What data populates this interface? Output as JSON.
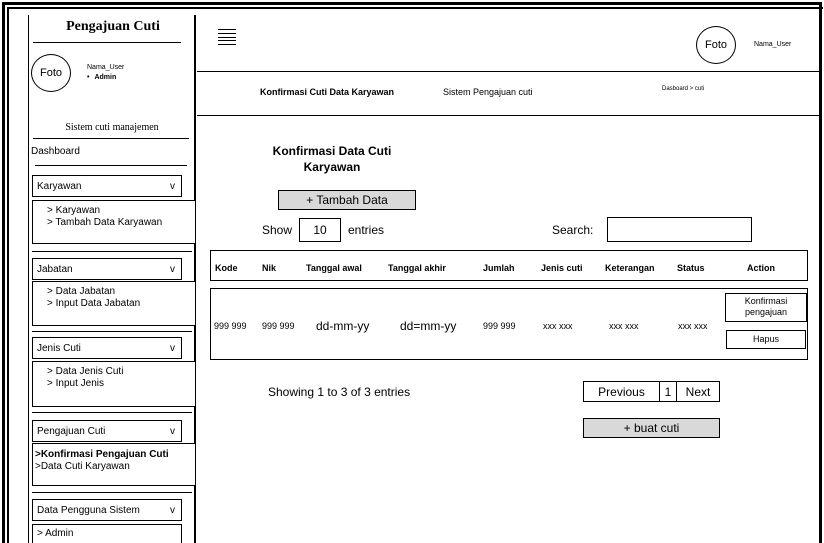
{
  "sidebar": {
    "app_title": "Pengajuan Cuti",
    "foto_label": "Foto",
    "user_name": "Nama_User",
    "user_role": "Admin",
    "subtitle": "Sistem cuti manajemen",
    "dashboard": "Dashboard",
    "karyawan": {
      "label": "Karyawan",
      "chevron": "v",
      "items": [
        "> Karyawan",
        "> Tambah Data Karyawan"
      ]
    },
    "jabatan": {
      "label": "Jabatan",
      "chevron": "v",
      "items": [
        "> Data Jabatan",
        "> Input Data Jabatan"
      ]
    },
    "jenis_cuti": {
      "label": "Jenis Cuti",
      "chevron": "v",
      "items": [
        "> Data Jenis Cuti",
        "> Input Jenis"
      ]
    },
    "pengajuan_cuti": {
      "label": "Pengajuan Cuti",
      "chevron": "v",
      "items": [
        ">Konfirmasi Pengajuan Cuti",
        ">Data Cuti Karyawan"
      ]
    },
    "data_pengguna": {
      "label": "Data Pengguna Sistem",
      "chevron": "v",
      "items": [
        "> Admin"
      ]
    }
  },
  "topbar": {
    "menu_icon": "hamburger-icon",
    "foto_label": "Foto",
    "user_name": "Nama_User"
  },
  "breadcrumb_bar": {
    "page": "Konfirmasi Cuti Data Karyawan",
    "system": "Sistem Pengajuan cuti",
    "path": "Dasboard > cuti"
  },
  "main": {
    "title": "Konfirmasi Data Cuti Karyawan",
    "add_button": "+ Tambah Data",
    "show_label": "Show",
    "entries_value": "10",
    "entries_label": "entries",
    "search_label": "Search:",
    "search_value": "",
    "columns": [
      "Kode",
      "Nik",
      "Tanggal  awal",
      "Tanggal akhir",
      "Jumlah",
      "Jenis cuti",
      "Keterangan",
      "Status",
      "Action"
    ],
    "row": {
      "kode": "999 999",
      "nik": "999 999",
      "tanggal_awal": "dd-mm-yy",
      "tanggal_akhir": "dd=mm-yy",
      "jumlah": "999 999",
      "jenis_cuti": "xxx xxx",
      "keterangan": "xxx xxx",
      "status": "xxx xxx",
      "confirm_button": "Konfirmasi pengajuan",
      "delete_button": "Hapus"
    },
    "info": "Showing 1 to 3 of 3 entries",
    "pager": {
      "previous": "Previous",
      "page": "1",
      "next": "Next"
    },
    "buat_cuti_button": "+ buat cuti"
  }
}
